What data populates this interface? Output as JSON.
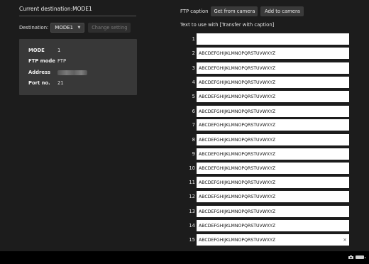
{
  "left": {
    "title": "Current destination:MODE1",
    "destination_label": "Destination:",
    "destination_value": "MODE1",
    "change_setting_label": "Change setting",
    "info": [
      {
        "key": "MODE",
        "value": "1"
      },
      {
        "key": "FTP mode",
        "value": "FTP"
      },
      {
        "key": "Address",
        "value": ""
      },
      {
        "key": "Port no.",
        "value": "21"
      }
    ]
  },
  "right": {
    "ftp_caption_label": "FTP caption",
    "get_from_camera_label": "Get from camera",
    "add_to_camera_label": "Add to camera",
    "text_label": "Text to use with [Transfer with caption]",
    "captions": [
      {
        "num": "1",
        "value": ""
      },
      {
        "num": "2",
        "value": "ABCDEFGHIJKLMNOPQRSTUVWXYZ"
      },
      {
        "num": "3",
        "value": "ABCDEFGHIJKLMNOPQRSTUVWXYZ"
      },
      {
        "num": "4",
        "value": "ABCDEFGHIJKLMNOPQRSTUVWXYZ"
      },
      {
        "num": "5",
        "value": "ABCDEFGHIJKLMNOPQRSTUVWXYZ"
      },
      {
        "num": "6",
        "value": "ABCDEFGHIJKLMNOPQRSTUVWXYZ"
      },
      {
        "num": "7",
        "value": "ABCDEFGHIJKLMNOPQRSTUVWXYZ"
      },
      {
        "num": "8",
        "value": "ABCDEFGHIJKLMNOPQRSTUVWXYZ"
      },
      {
        "num": "9",
        "value": "ABCDEFGHIJKLMNOPQRSTUVWXYZ"
      },
      {
        "num": "10",
        "value": "ABCDEFGHIJKLMNOPQRSTUVWXYZ"
      },
      {
        "num": "11",
        "value": "ABCDEFGHIJKLMNOPQRSTUVWXYZ"
      },
      {
        "num": "12",
        "value": "ABCDEFGHIJKLMNOPQRSTUVWXYZ"
      },
      {
        "num": "13",
        "value": "ABCDEFGHIJKLMNOPQRSTUVWXYZ"
      },
      {
        "num": "14",
        "value": "ABCDEFGHIJKLMNOPQRSTUVWXYZ"
      },
      {
        "num": "15",
        "value": "ABCDEFGHIJKLMNOPQRSTUVWXYZ",
        "clear": "×"
      }
    ]
  },
  "status_bar": {
    "icons": [
      "camera-icon",
      "battery-icon"
    ]
  }
}
